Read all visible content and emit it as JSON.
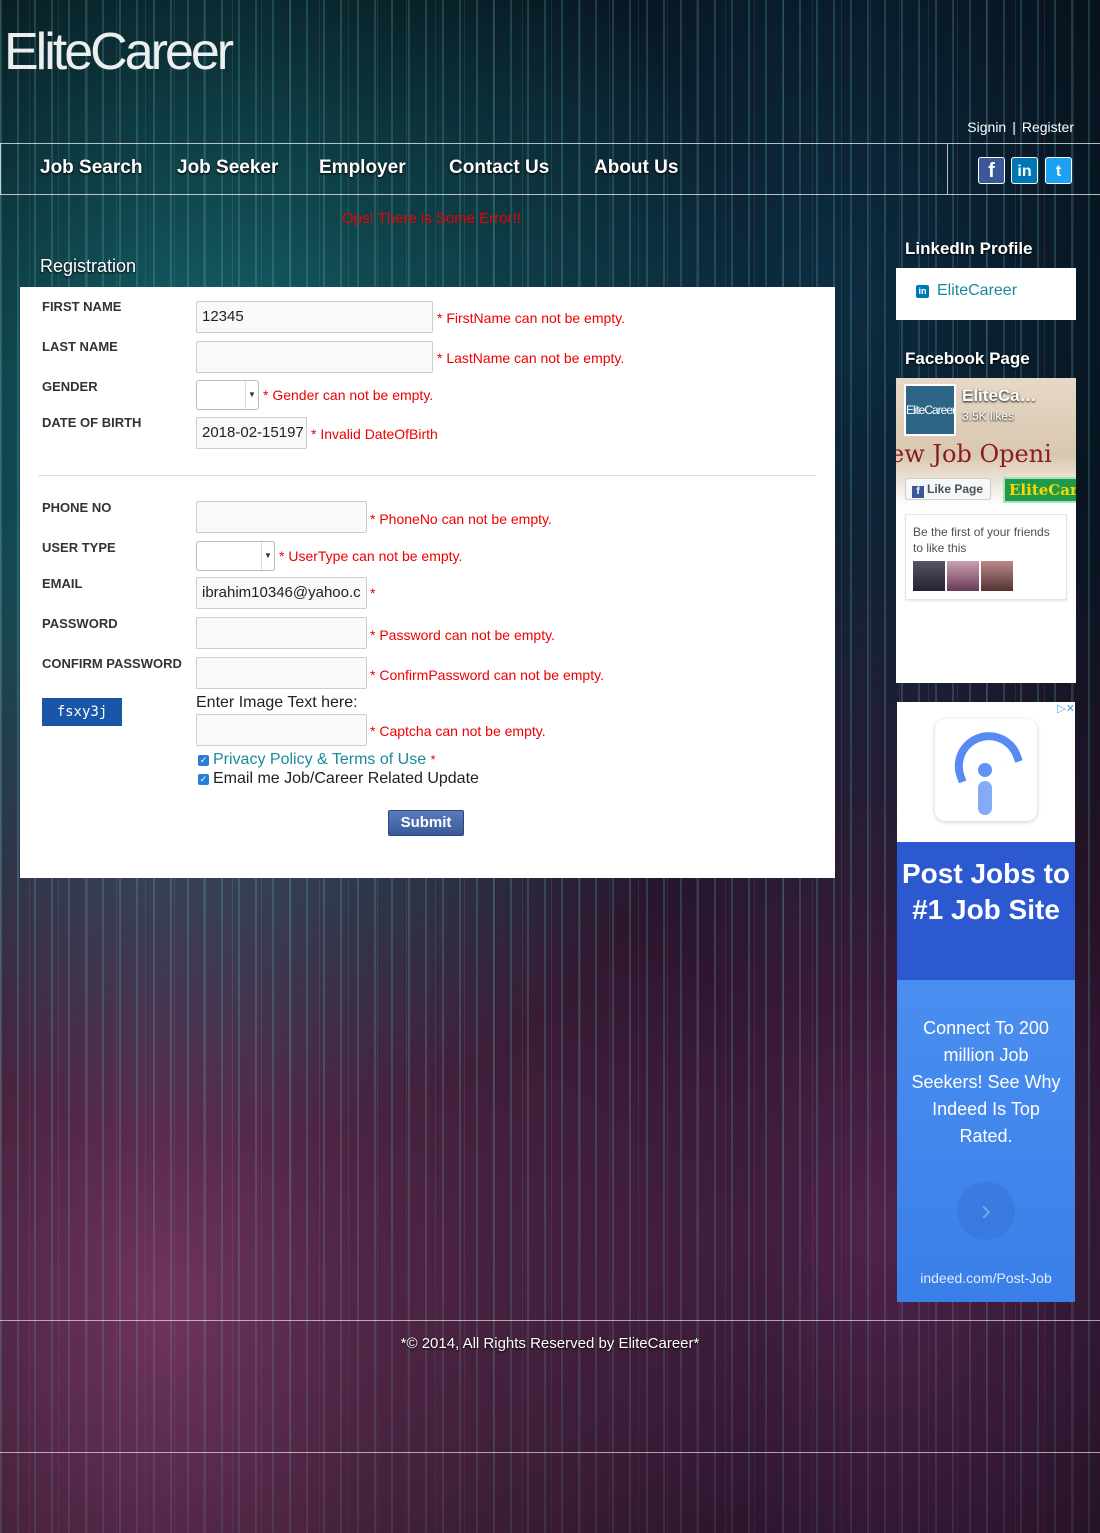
{
  "brand": {
    "logo": "EliteCareer"
  },
  "auth": {
    "signin": "Signin",
    "separator": "|",
    "register": "Register"
  },
  "nav": {
    "items": [
      "Job Search",
      "Job Seeker",
      "Employer",
      "Contact Us",
      "About Us"
    ],
    "social": {
      "facebook": "f",
      "linkedin": "in",
      "twitter": "t"
    }
  },
  "page": {
    "error_message": "Ops! There is Some Error!!",
    "section_title": "Registration"
  },
  "form": {
    "first_name": {
      "label": "FIRST NAME",
      "value": "12345",
      "error": "* FirstName can not be empty."
    },
    "last_name": {
      "label": "LAST NAME",
      "value": "",
      "error": "* LastName can not be empty."
    },
    "gender": {
      "label": "GENDER",
      "value": "",
      "error": "* Gender can not be empty."
    },
    "dob": {
      "label": "DATE OF BIRTH",
      "value": "2018-02-15197",
      "error": "* Invalid DateOfBirth"
    },
    "phone": {
      "label": "PHONE NO",
      "value": "",
      "error": "* PhoneNo can not be empty."
    },
    "user_type": {
      "label": "USER TYPE",
      "value": "",
      "error": "* UserType can not be empty."
    },
    "email": {
      "label": "EMAIL",
      "value": "ibrahim10346@yahoo.c",
      "error": "*"
    },
    "password": {
      "label": "PASSWORD",
      "value": "",
      "error": "* Password can not be empty."
    },
    "confirm_password": {
      "label": "CONFIRM PASSWORD",
      "value": "",
      "error": "* ConfirmPassword can not be empty."
    },
    "captcha": {
      "image_text": "fsxy3j",
      "prompt": "Enter Image Text here:",
      "value": "",
      "error": "* Captcha can not be empty."
    },
    "privacy": {
      "label": "Privacy Policy & Terms of Use",
      "required": "*",
      "checked": true
    },
    "email_updates": {
      "label": "Email me Job/Career Related Update",
      "checked": true
    },
    "submit_label": "Submit"
  },
  "sidebar": {
    "linkedin": {
      "title": "LinkedIn Profile",
      "link": "EliteCareer"
    },
    "facebook": {
      "title": "Facebook Page",
      "page_name": "EliteCa…",
      "likes": "3.5K likes",
      "thumb_text": "EliteCareer",
      "banner_text": "ew Job Openi",
      "like_button": "Like Page",
      "brand_badge": "EliteCar",
      "friends_text": "Be the first of your friends to like this"
    },
    "ad": {
      "headline": "Post Jobs to #1 Job Site",
      "body": "Connect To 200 million Job Seekers! See Why Indeed Is Top Rated.",
      "url": "indeed.com/Post-Job",
      "close": "▷✕"
    }
  },
  "footer": {
    "copyright": "*© 2014, All Rights Reserved by EliteCareer*"
  },
  "colors": {
    "error": "#ee0000",
    "link": "#1a8a9a",
    "fb_blue": "#3b5998",
    "ad_blue": "#2c58d0"
  }
}
